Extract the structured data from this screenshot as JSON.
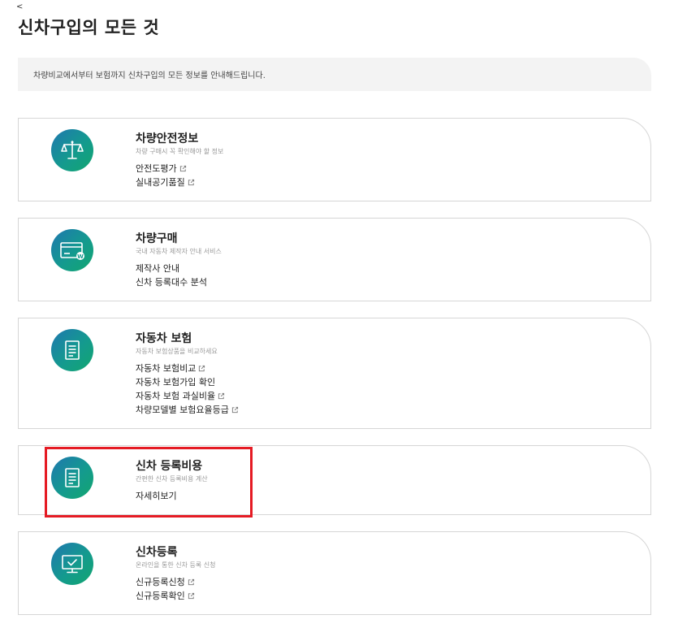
{
  "header": {
    "back_label": "<",
    "title": "신차구입의 모든 것"
  },
  "intro": {
    "text": "차량비교에서부터 보험까지 신차구입의 모든 정보를 안내해드립니다."
  },
  "cards": [
    {
      "icon": "scales-icon",
      "title": "차량안전정보",
      "subtitle": "차량 구매시 꼭 확인해야 할 정보",
      "links": [
        {
          "label": "안전도평가",
          "external": true
        },
        {
          "label": "실내공기품질",
          "external": true
        }
      ]
    },
    {
      "icon": "credit-card-icon",
      "title": "차량구매",
      "subtitle": "국내 자동차 제작자 안내 서비스",
      "links": [
        {
          "label": "제작사 안내",
          "external": false
        },
        {
          "label": "신차 등록대수 분석",
          "external": false
        }
      ]
    },
    {
      "icon": "document-icon",
      "title": "자동차 보험",
      "subtitle": "자동차 보험상품을 비교하세요",
      "links": [
        {
          "label": "자동차 보험비교",
          "external": true
        },
        {
          "label": "자동차 보험가입 확인",
          "external": false
        },
        {
          "label": "자동차 보험 과실비율",
          "external": true
        },
        {
          "label": "차량모델별 보험요율등급",
          "external": true
        }
      ]
    },
    {
      "icon": "document-icon",
      "title": "신차 등록비용",
      "subtitle": "간편한 신차 등록비용 계산",
      "links": [
        {
          "label": "자세히보기",
          "external": false
        }
      ]
    },
    {
      "icon": "monitor-check-icon",
      "title": "신차등록",
      "subtitle": "온라인을 통한 신차 등록 신청",
      "links": [
        {
          "label": "신규등록신청",
          "external": true
        },
        {
          "label": "신규등록확인",
          "external": true
        }
      ]
    }
  ],
  "colors": {
    "highlight": "#e51b24",
    "icon_gradient_start": "#1f77b0",
    "icon_gradient_end": "#12a66f"
  }
}
